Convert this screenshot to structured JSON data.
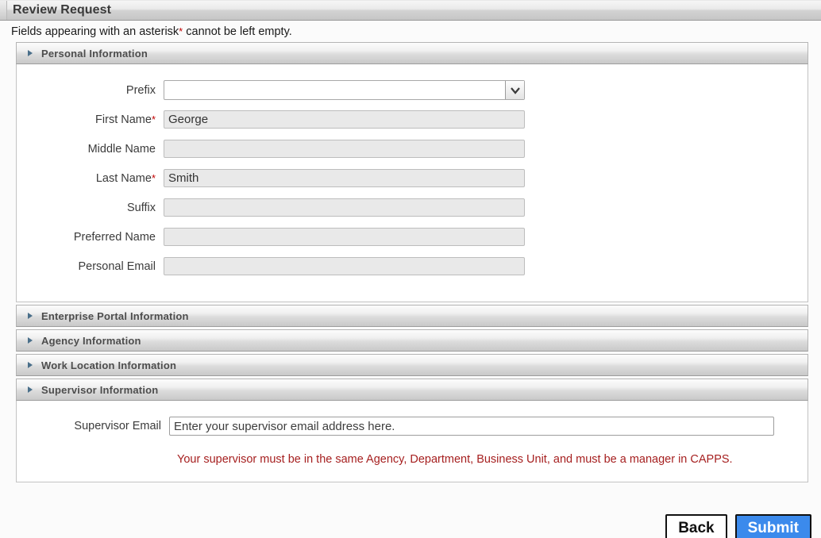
{
  "window": {
    "title": "Review Request"
  },
  "notice": {
    "prefix": "Fields appearing with an asterisk",
    "star": "*",
    "suffix": " cannot be left empty."
  },
  "sections": [
    {
      "id": "personal",
      "title": "Personal Information",
      "expanded": true
    },
    {
      "id": "portal",
      "title": "Enterprise Portal Information",
      "expanded": false
    },
    {
      "id": "agency",
      "title": "Agency Information",
      "expanded": false
    },
    {
      "id": "worklocation",
      "title": "Work Location Information",
      "expanded": false
    },
    {
      "id": "supervisor",
      "title": "Supervisor Information",
      "expanded": true
    }
  ],
  "personal_fields": {
    "prefix": {
      "label": "Prefix",
      "required": false,
      "type": "select",
      "value": "",
      "options": [
        ""
      ]
    },
    "first_name": {
      "label": "First Name",
      "required": true,
      "type": "text",
      "value": "George",
      "placeholder": ""
    },
    "middle_name": {
      "label": "Middle Name",
      "required": false,
      "type": "text",
      "value": "",
      "placeholder": ""
    },
    "last_name": {
      "label": "Last Name",
      "required": true,
      "type": "text",
      "value": "Smith",
      "placeholder": ""
    },
    "suffix": {
      "label": "Suffix",
      "required": false,
      "type": "text",
      "value": "",
      "placeholder": ""
    },
    "preferred_name": {
      "label": "Preferred Name",
      "required": false,
      "type": "text",
      "value": "",
      "placeholder": ""
    },
    "personal_email": {
      "label": "Personal Email",
      "required": false,
      "type": "text",
      "value": "",
      "placeholder": ""
    }
  },
  "supervisor_section": {
    "email_label": "Supervisor Email",
    "email_value": "",
    "email_placeholder": "Enter your supervisor email address here.",
    "warning": "Your supervisor must be in the same Agency, Department, Business Unit, and must be a manager in CAPPS.",
    "warning_color": "#a62020"
  },
  "buttons": {
    "back": "Back",
    "submit": "Submit",
    "submit_color": "#3b8aec"
  },
  "icons": {
    "collapse_triangle": "triangle-right-icon",
    "select_chevron": "chevron-down-icon"
  },
  "required_marker": "*"
}
